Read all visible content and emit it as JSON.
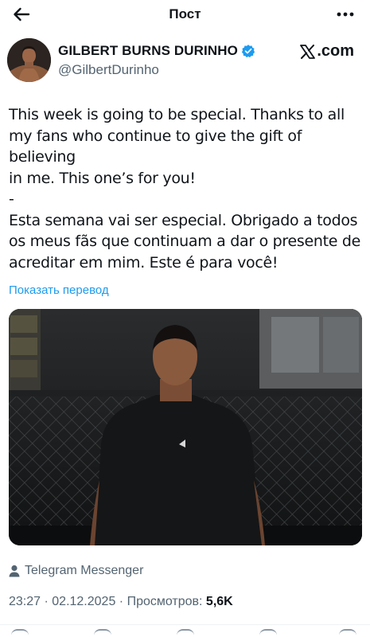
{
  "topbar": {
    "title": "Пост",
    "back_icon": "arrow-left-icon",
    "more_icon": "more-horizontal-icon"
  },
  "author": {
    "display_name": "GILBERT BURNS DURINHO",
    "handle": "@GilbertDurinho",
    "verified_icon": "verified-badge-icon",
    "verified_color": "#1d9bf0"
  },
  "watermark": {
    "label": ".com",
    "icon": "x-logo-icon"
  },
  "tweet": {
    "text": "This week is going to be special. Thanks to all\nmy fans who continue to give the gift of believing\nin me. This one’s for you!\n-\nEsta semana vai ser especial. Obrigado a todos\nos meus fãs que continuam a dar o presente de\nacreditar em mim. Este é para você!",
    "translate_label": "Показать перевод",
    "link_color": "#1d9bf0"
  },
  "source": {
    "icon": "person-icon",
    "label": "Telegram Messenger"
  },
  "meta": {
    "time": "23:27",
    "sep1": " · ",
    "date": "02.12.2025",
    "sep2": " · ",
    "views_label": "Просмотров: ",
    "views_count": "5,6K"
  }
}
